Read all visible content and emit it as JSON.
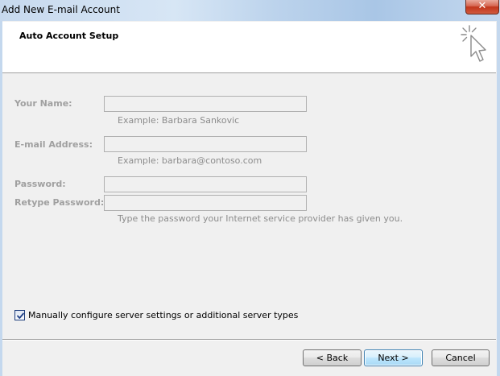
{
  "window": {
    "title": "Add New E-mail Account",
    "close_glyph": "✕"
  },
  "header": {
    "title": "Auto Account Setup",
    "icon": "cursor-sparkle-icon"
  },
  "form": {
    "your_name": {
      "label": "Your Name:",
      "value": "",
      "hint": "Example: Barbara Sankovic"
    },
    "email": {
      "label": "E-mail Address:",
      "value": "",
      "hint": "Example: barbara@contoso.com"
    },
    "password": {
      "label": "Password:",
      "value": ""
    },
    "retype_password": {
      "label": "Retype Password:",
      "value": "",
      "hint": "Type the password your Internet service provider has given you."
    }
  },
  "manual_config": {
    "checked": true,
    "label": "Manually configure server settings or additional server types"
  },
  "buttons": {
    "back": "< Back",
    "next": "Next >",
    "cancel": "Cancel"
  }
}
